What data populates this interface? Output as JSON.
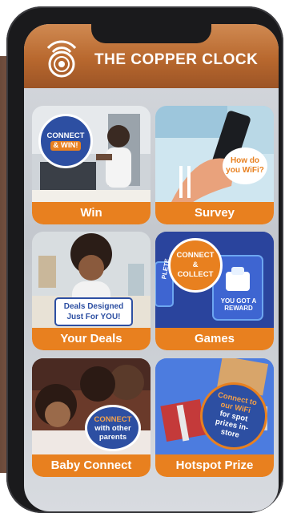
{
  "brand": {
    "name": "THE COPPER CLOCK",
    "logo_icon": "copper-clock-wifi-logo"
  },
  "colors": {
    "accent": "#e8801f",
    "header": "#b8682e",
    "badge_blue": "#2d4fa2"
  },
  "tiles": [
    {
      "label": "Win",
      "badge_line1": "CONNECT",
      "badge_line2": "& WIN!"
    },
    {
      "label": "Survey",
      "badge_line1": "How do",
      "badge_line2": "you WiFi?"
    },
    {
      "label": "Your Deals",
      "badge_line1": "Deals Designed",
      "badge_line2": "Just For YOU!"
    },
    {
      "label": "Games",
      "badge_line1": "CONNECT",
      "badge_line2": "&",
      "badge_line3": "COLLECT",
      "screen_text_1": "YOU GOT A REWARD",
      "screen_text_2": "PLETE"
    },
    {
      "label": "Baby Connect",
      "badge_line1": "CONNECT",
      "badge_line2": "with other",
      "badge_line3": "parents"
    },
    {
      "label": "Hotspot Prize",
      "badge_line1": "Connect to",
      "badge_line2": "our WiFi",
      "badge_line3": "for spot",
      "badge_line4": "prizes in-",
      "badge_line5": "store"
    }
  ]
}
